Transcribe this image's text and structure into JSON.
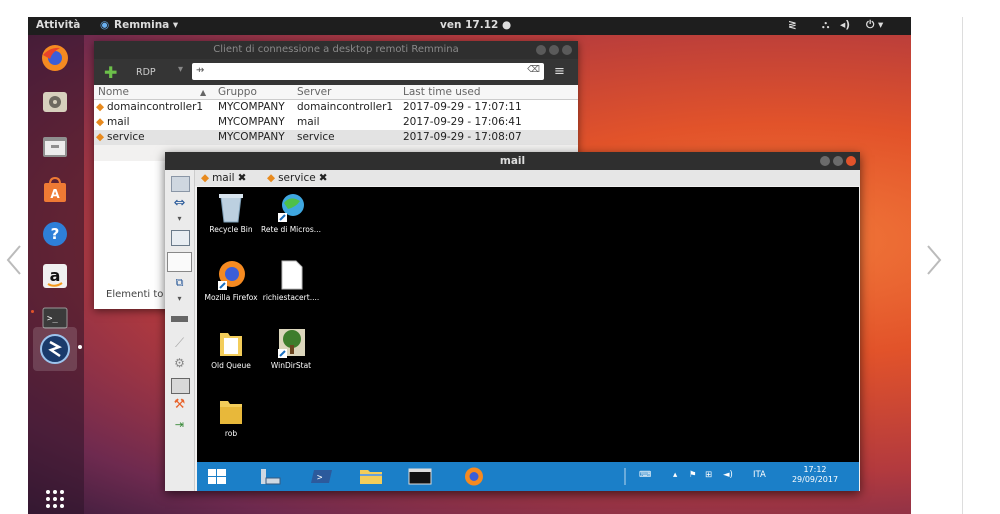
{
  "topbar": {
    "activities": "Attività",
    "app_menu": "Remmina ▾",
    "clock": "ven 17.12 ●"
  },
  "remmina": {
    "title": "Client di connessione a desktop remoti Remmina",
    "protocol": "RDP",
    "columns": [
      "Nome",
      "Gruppo",
      "Server",
      "Last time used"
    ],
    "rows": [
      {
        "name": "domaincontroller1",
        "group": "MYCOMPANY",
        "server": "domaincontroller1",
        "last": "2017-09-29 - 17:07:11"
      },
      {
        "name": "mail",
        "group": "MYCOMPANY",
        "server": "mail",
        "last": "2017-09-29 - 17:06:41"
      },
      {
        "name": "service",
        "group": "MYCOMPANY",
        "server": "service",
        "last": "2017-09-29 - 17:08:07"
      }
    ],
    "status": "Elementi to"
  },
  "mail_window": {
    "title": "mail",
    "tabs": [
      "mail",
      "service"
    ]
  },
  "desktop": {
    "icons": [
      "Recycle Bin",
      "Rete di Micros...",
      "Mozilla Firefox",
      "richiestacert....",
      "Old Queue",
      "WinDirStat",
      "rob"
    ]
  },
  "taskbar": {
    "lang": "ITA",
    "time": "17:12",
    "date": "29/09/2017"
  },
  "colors": {
    "ubuntu_orange": "#e2532a",
    "win_taskbar": "#1b7fc8",
    "selected_row": "#e3e3e3"
  }
}
